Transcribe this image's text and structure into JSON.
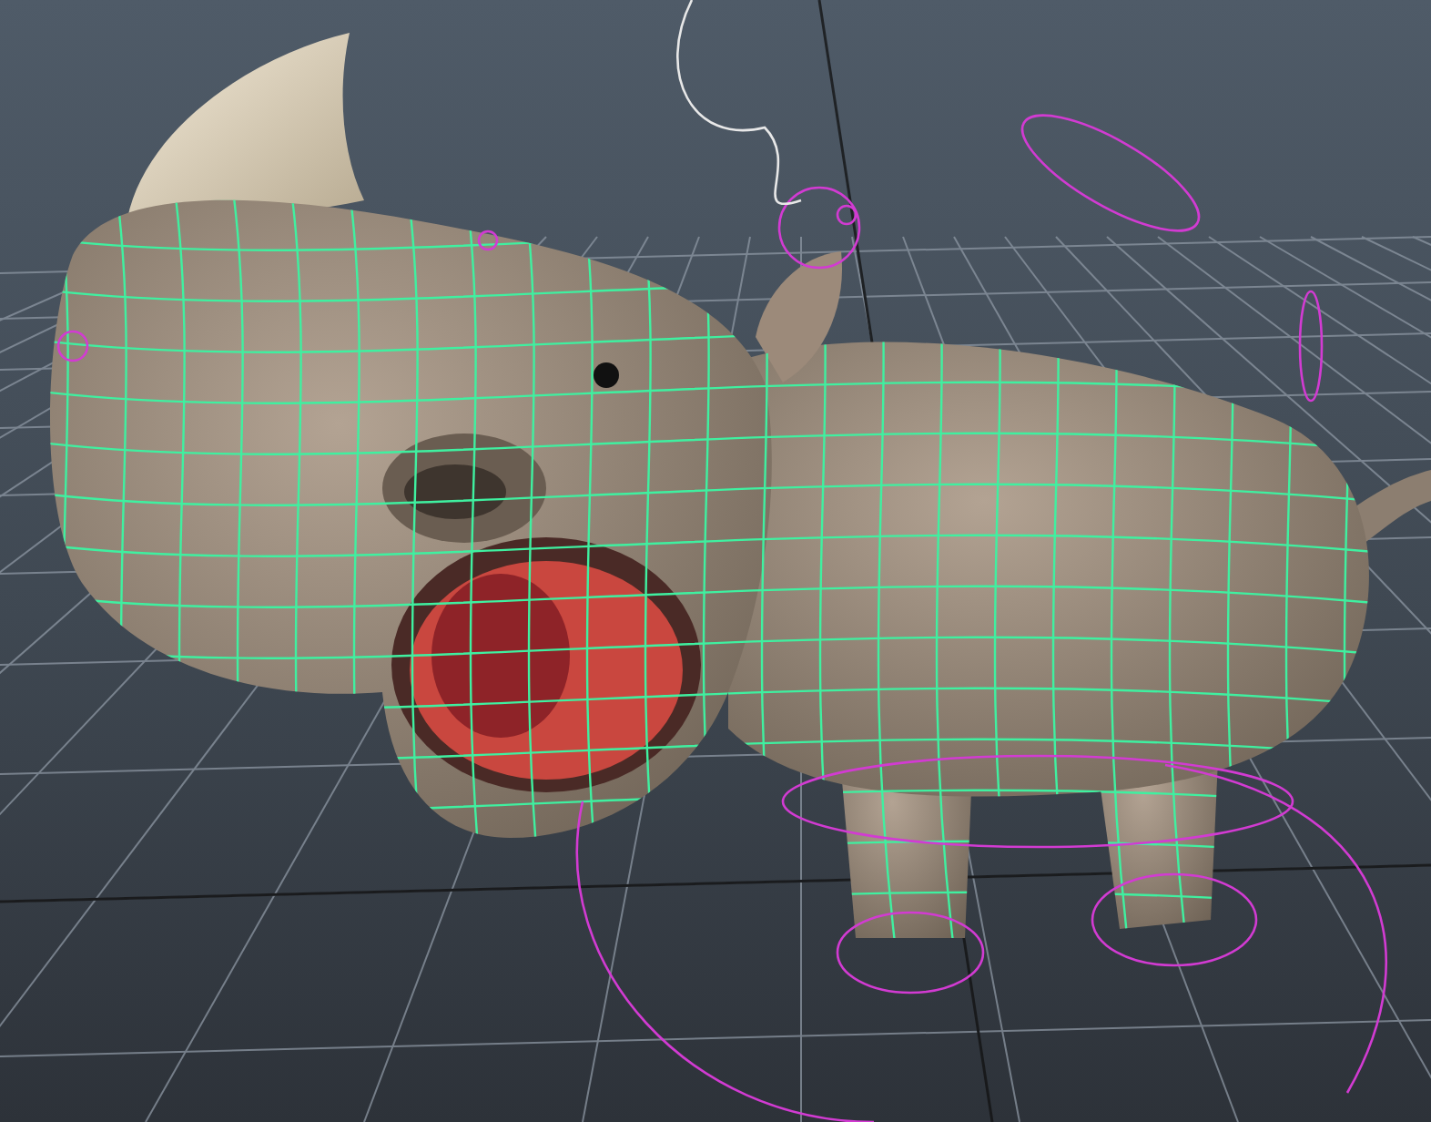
{
  "viewport": {
    "grid": true,
    "wireframe_on_shaded": true,
    "rig_controls": true
  }
}
